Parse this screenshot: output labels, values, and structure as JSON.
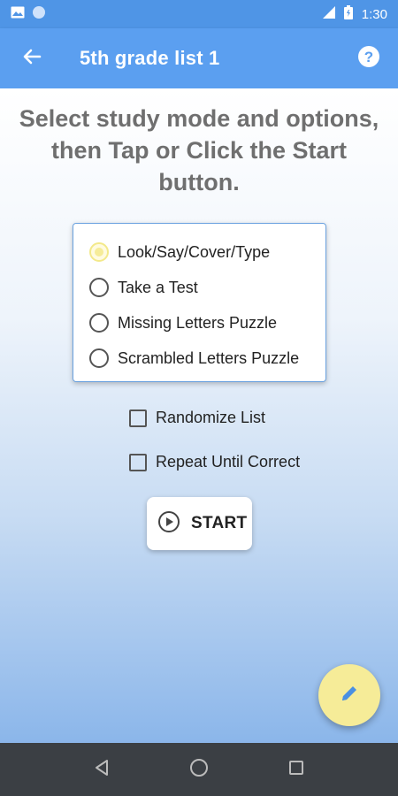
{
  "status_bar": {
    "time": "1:30",
    "icons": [
      "image-notification-icon",
      "circle-notification-icon",
      "signal-icon",
      "battery-icon"
    ]
  },
  "app_bar": {
    "title": "5th grade list 1",
    "back_icon": "back-arrow-icon",
    "help_icon": "help-icon"
  },
  "instructions": {
    "line1": "Select study mode and options,",
    "line2": "then Tap or Click the Start",
    "line3": "button."
  },
  "modes": {
    "selected": "Look/Say/Cover/Type",
    "options": [
      "Look/Say/Cover/Type",
      "Take a Test",
      "Missing Letters Puzzle",
      "Scrambled Letters Puzzle"
    ]
  },
  "options": {
    "randomize": {
      "label": "Randomize List",
      "checked": false
    },
    "repeat": {
      "label": "Repeat Until Correct",
      "checked": false
    }
  },
  "start_button": {
    "label": "START",
    "icon": "play-circle-icon"
  },
  "fab": {
    "icon": "pencil-icon"
  },
  "nav": {
    "icons": [
      "nav-back-icon",
      "nav-home-icon",
      "nav-recents-icon"
    ]
  },
  "colors": {
    "app_bar": "#5b9ff0",
    "status_bar": "#4f95e6",
    "accent": "#f6ec98",
    "nav_bar": "#3b3f44"
  }
}
